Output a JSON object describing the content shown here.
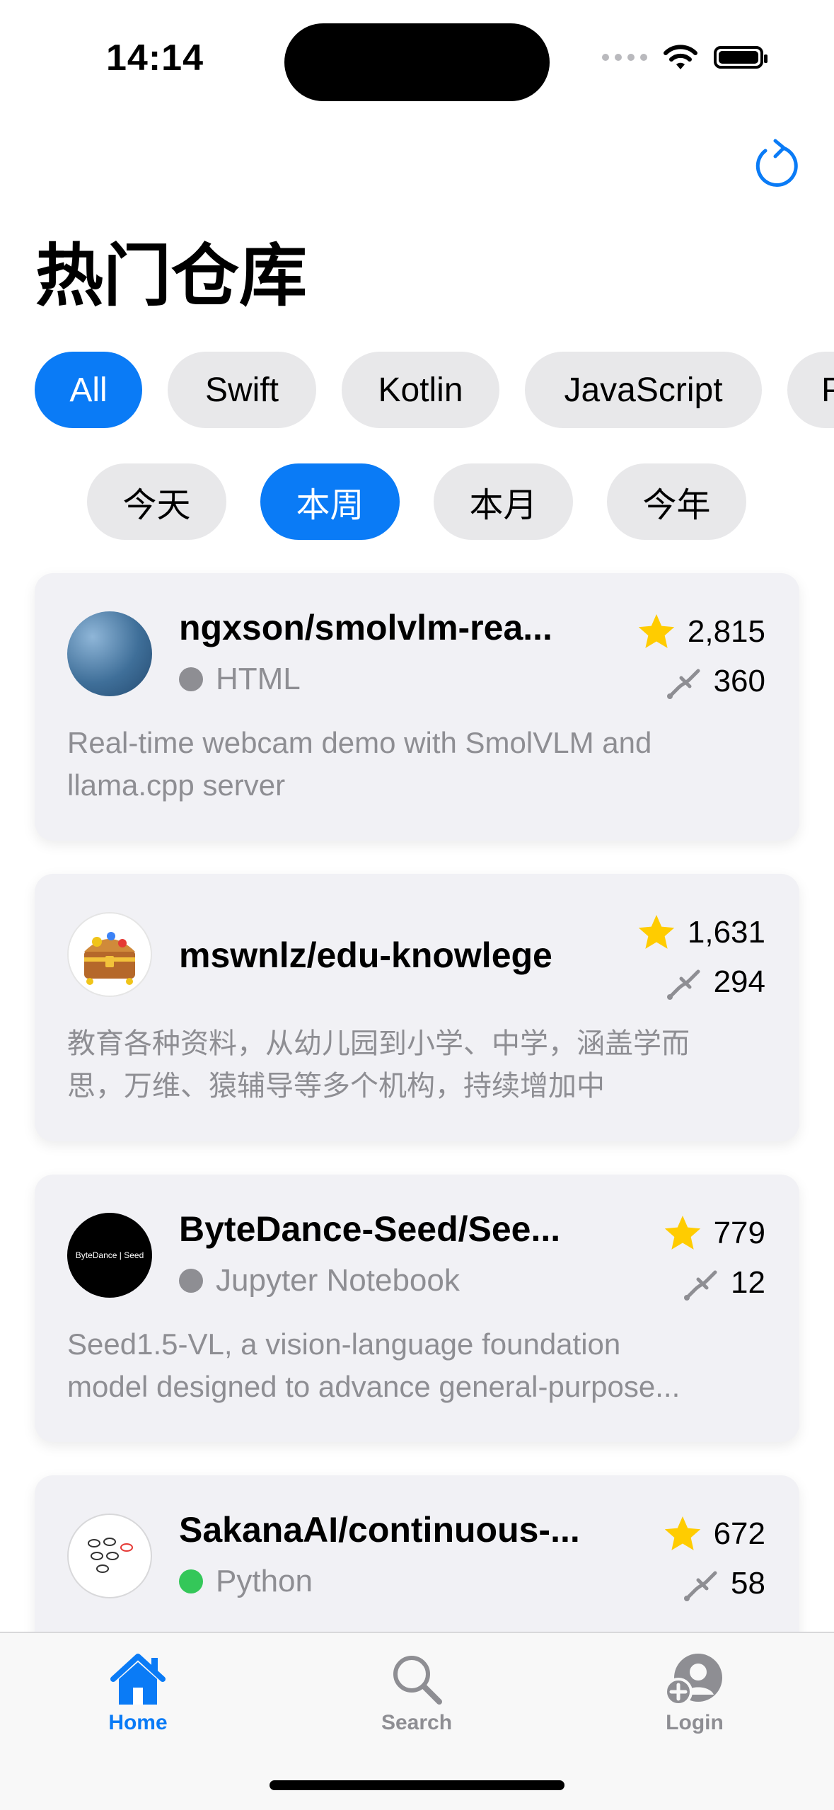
{
  "status_bar": {
    "time": "14:14"
  },
  "page": {
    "title": "热门仓库"
  },
  "languages": [
    {
      "label": "All",
      "active": true
    },
    {
      "label": "Swift",
      "active": false
    },
    {
      "label": "Kotlin",
      "active": false
    },
    {
      "label": "JavaScript",
      "active": false
    },
    {
      "label": "P",
      "active": false
    }
  ],
  "periods": [
    {
      "label": "今天",
      "active": false
    },
    {
      "label": "本周",
      "active": true
    },
    {
      "label": "本月",
      "active": false
    },
    {
      "label": "今年",
      "active": false
    }
  ],
  "repos": [
    {
      "name": "ngxson/smolvlm-rea...",
      "language": "HTML",
      "language_color": "#8e8e93",
      "stars": "2,815",
      "forks": "360",
      "desc_line1": "Real-time webcam demo with SmolVLM and",
      "desc_line2": "llama.cpp server"
    },
    {
      "name": "mswnlz/edu-knowlege",
      "stars": "1,631",
      "forks": "294",
      "desc_line1": "教育各种资料，从幼儿园到小学、中学，涵盖学而",
      "desc_line2": "思，万维、猿辅导等多个机构，持续增加中"
    },
    {
      "name": "ByteDance-Seed/See...",
      "language": "Jupyter Notebook",
      "language_color": "#8e8e93",
      "stars": "779",
      "forks": "12",
      "avatar_text": "ByteDance | Seed",
      "desc_line1": "Seed1.5-VL, a vision-language foundation",
      "desc_line2": "model designed to advance general-purpose..."
    },
    {
      "name": "SakanaAI/continuous-...",
      "language": "Python",
      "language_color": "#34c759",
      "stars": "672",
      "forks": "58"
    }
  ],
  "tabbar": {
    "home": "Home",
    "search": "Search",
    "login": "Login"
  },
  "colors": {
    "accent": "#0a7bf6",
    "star": "#ffcc00",
    "chip_bg": "#e8e8ea",
    "card_bg": "#f1f1f5"
  }
}
